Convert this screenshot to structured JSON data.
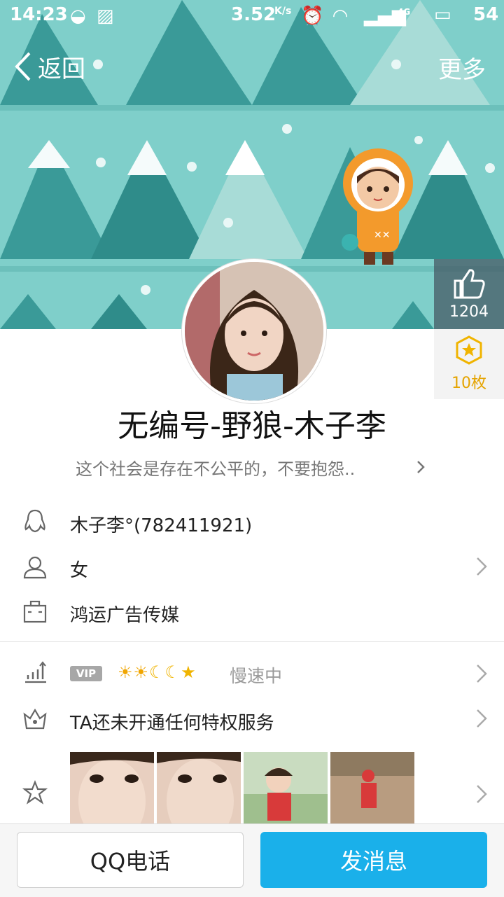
{
  "status_bar": {
    "time": "14:23",
    "speed": "3.52",
    "speed_unit": "K/s",
    "network": "4G",
    "battery": "54"
  },
  "nav": {
    "back_label": "返回",
    "more_label": "更多"
  },
  "likes": {
    "count": "1204",
    "icon": "thumbs-up-icon"
  },
  "badge": {
    "count_label": "10枚",
    "icon": "star-badge-icon"
  },
  "profile": {
    "name": "无编号-野狼-木子李",
    "signature": "这个社会是存在不公平的，不要抱怨.."
  },
  "info_rows": [
    {
      "icon": "qq-penguin-icon",
      "text": "木子李°(782411921)"
    },
    {
      "icon": "person-icon",
      "text": "女"
    },
    {
      "icon": "briefcase-icon",
      "text": "鸿运广告传媒"
    }
  ],
  "level_row": {
    "vip_label": "VIP",
    "level_icons": "☀☀☾☾★",
    "status": "慢速中"
  },
  "privilege_row": {
    "text": "TA还未开通任何特权服务"
  },
  "buttons": {
    "call_label": "QQ电话",
    "message_label": "发消息"
  },
  "colors": {
    "primary": "#1ab0ea",
    "banner": "#7fcfca",
    "tree_dark": "#3a9a98"
  }
}
